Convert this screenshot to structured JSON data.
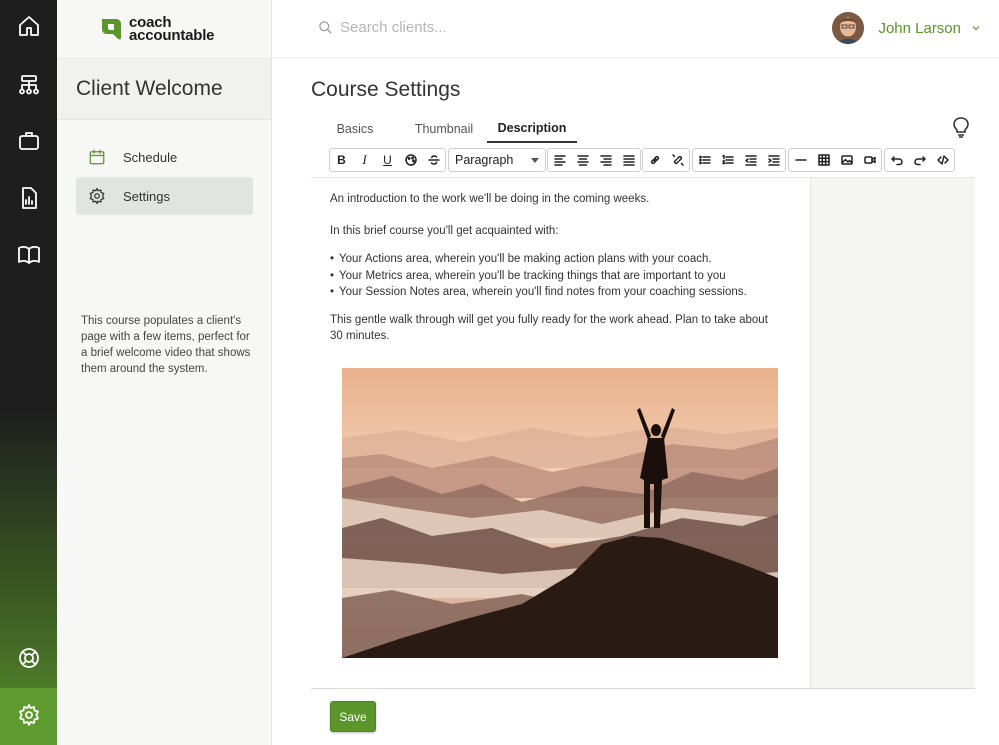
{
  "brand": {
    "line1": "coach",
    "line2": "accountable",
    "color": "#5a962a"
  },
  "sidebar": {
    "title": "Client Welcome",
    "items": [
      {
        "label": "Schedule",
        "icon": "calendar-icon",
        "active": false
      },
      {
        "label": "Settings",
        "icon": "gear-icon",
        "active": true
      }
    ],
    "description": "This course populates a client's page with a few items, perfect for a brief welcome video that shows them around the system."
  },
  "rail": {
    "icons": [
      "home-icon",
      "hierarchy-icon",
      "briefcase-icon",
      "report-icon",
      "book-icon",
      "lifebuoy-icon",
      "gear-icon"
    ]
  },
  "search": {
    "placeholder": "Search clients..."
  },
  "user": {
    "name": "John Larson"
  },
  "page": {
    "title": "Course Settings"
  },
  "tabs": [
    {
      "label": "Basics",
      "active": false
    },
    {
      "label": "Thumbnail",
      "active": false
    },
    {
      "label": "Description",
      "active": true
    }
  ],
  "toolbar": {
    "format_select": "Paragraph",
    "buttons": [
      "bold",
      "italic",
      "underline",
      "color",
      "strikethrough",
      "align-left",
      "align-center",
      "align-right",
      "justify",
      "link",
      "unlink",
      "bullet-list",
      "numbered-list",
      "outdent",
      "indent",
      "horizontal-rule",
      "table",
      "image",
      "video",
      "undo",
      "redo",
      "source-code"
    ]
  },
  "editor": {
    "intro": "An introduction to the work we'll be doing in the coming weeks.",
    "lead": "In this brief course you'll get acquainted with:",
    "bullets": [
      "Your Actions area, wherein you'll be making action plans with your coach.",
      "Your Metrics area, wherein you'll be tracking things that are important to you",
      "Your Session Notes area, wherein you'll find notes from your coaching sessions."
    ],
    "closing_line1": "This gentle walk through will get you fully ready for the work ahead.  Plan to take about",
    "closing_line2": "30 minutes."
  },
  "actions": {
    "save_label": "Save"
  }
}
